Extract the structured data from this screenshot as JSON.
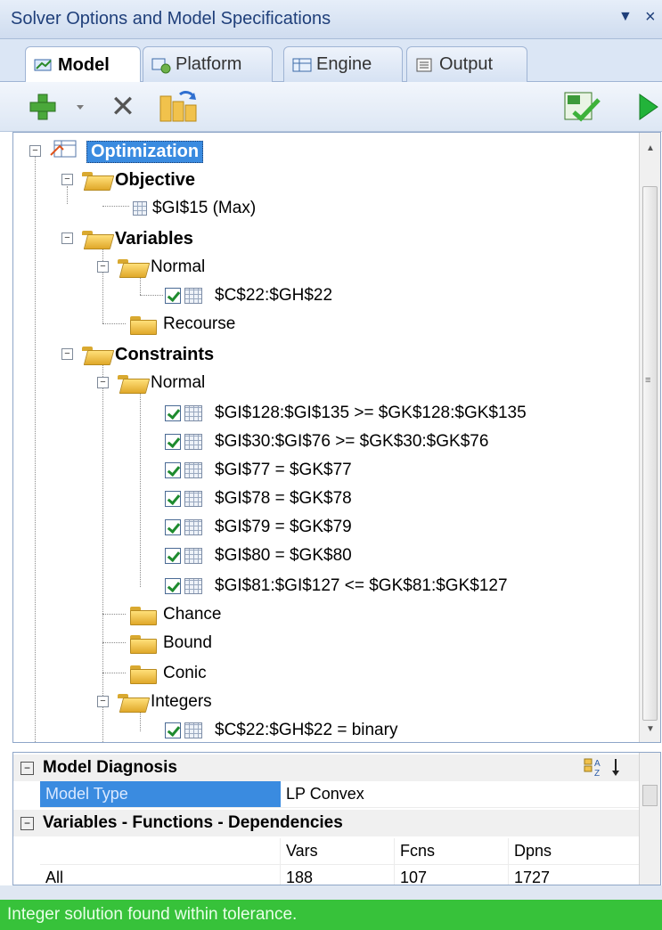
{
  "window": {
    "title": "Solver Options and Model Specifications",
    "menu_arrow": "▼",
    "close_glyph": "×"
  },
  "tabs": [
    {
      "label": "Model",
      "active": true
    },
    {
      "label": "Platform",
      "active": false
    },
    {
      "label": "Engine",
      "active": false
    },
    {
      "label": "Output",
      "active": false
    }
  ],
  "toolbar": {
    "add_icon": "plus-icon",
    "dropdown_icon": "chevron-down-icon",
    "delete_icon": "x-icon",
    "refresh_icon": "refresh-icon",
    "analyze_icon": "check-sheet-icon",
    "solve_icon": "play-icon",
    "delete_glyph": "✕"
  },
  "tree": {
    "root": "Optimization",
    "objective": {
      "label": "Objective",
      "item": "$GI$15 (Max)"
    },
    "variables": {
      "label": "Variables",
      "normal": {
        "label": "Normal",
        "item": "$C$22:$GH$22"
      },
      "recourse": "Recourse"
    },
    "constraints": {
      "label": "Constraints",
      "normal": {
        "label": "Normal",
        "items": [
          "$GI$128:$GI$135 >= $GK$128:$GK$135",
          "$GI$30:$GI$76 >= $GK$30:$GK$76",
          "$GI$77 = $GK$77",
          "$GI$78 = $GK$78",
          "$GI$79 = $GK$79",
          "$GI$80 = $GK$80",
          "$GI$81:$GI$127 <= $GK$81:$GK$127"
        ]
      },
      "chance": "Chance",
      "bound": "Bound",
      "conic": "Conic",
      "integers": {
        "label": "Integers",
        "item": "$C$22:$GH$22 = binary"
      }
    }
  },
  "properties": {
    "diagnosis": {
      "label": "Model Diagnosis",
      "model_type_label": "Model Type",
      "model_type_value": "LP Convex"
    },
    "dependencies": {
      "label": "Variables - Functions - Dependencies",
      "headers": [
        "",
        "Vars",
        "Fcns",
        "Dpns"
      ],
      "rows": [
        [
          "All",
          "188",
          "107",
          "1727"
        ]
      ]
    },
    "collapse_glyph": "⊟"
  },
  "status": {
    "message": "Integer solution found within tolerance.",
    "color": "#37c23a"
  }
}
